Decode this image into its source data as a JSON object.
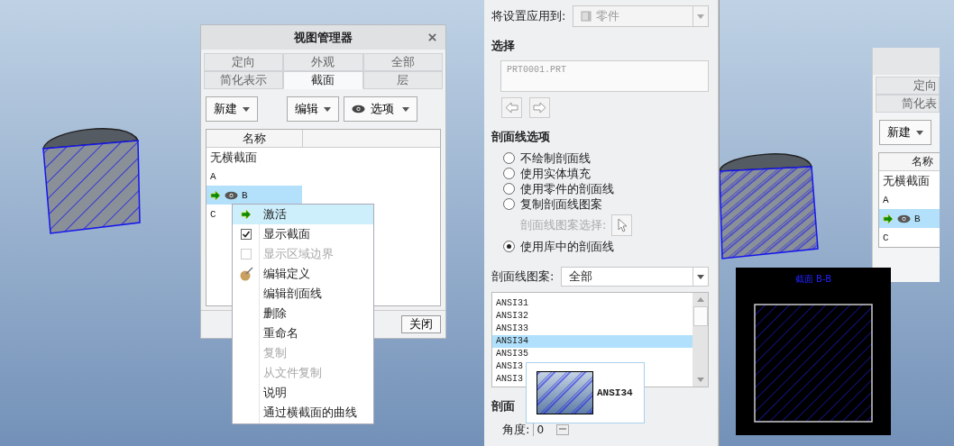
{
  "left_view": {
    "view_manager": {
      "title": "视图管理器",
      "tab_rows": [
        {
          "tabs": [
            {
              "label": "定向",
              "selected": false
            },
            {
              "label": "外观",
              "selected": false
            },
            {
              "label": "全部",
              "selected": false
            }
          ]
        },
        {
          "tabs": [
            {
              "label": "简化表示",
              "selected": false
            },
            {
              "label": "截面",
              "selected": true
            },
            {
              "label": "层",
              "selected": false
            }
          ]
        }
      ],
      "toolbar": [
        {
          "label": "新建",
          "kind": "plain"
        },
        {
          "label": "编辑",
          "kind": "plain"
        },
        {
          "label": "选项",
          "kind": "eye"
        }
      ],
      "column": "名称",
      "rows": [
        {
          "label": "无横截面",
          "selected": false,
          "active": false,
          "shown": false
        },
        {
          "label": "A",
          "selected": false,
          "active": false,
          "shown": false
        },
        {
          "label": "B",
          "selected": true,
          "active": true,
          "shown": true
        },
        {
          "label": "C",
          "selected": false,
          "active": false,
          "shown": false
        }
      ],
      "close_button": "关闭"
    },
    "context_menu": [
      {
        "label": "激活",
        "kind": "arrow",
        "selected": true,
        "disabled": false
      },
      {
        "label": "显示截面",
        "kind": "checkbox",
        "checked": true,
        "selected": false,
        "disabled": false
      },
      {
        "label": "显示区域边界",
        "kind": "checkbox",
        "checked": false,
        "selected": false,
        "disabled": true
      },
      {
        "label": "编辑定义",
        "kind": "brush",
        "selected": false,
        "disabled": false
      },
      {
        "label": "编辑剖面线",
        "kind": "plain",
        "selected": false,
        "disabled": false
      },
      {
        "label": "删除",
        "kind": "plain",
        "selected": false,
        "disabled": false
      },
      {
        "label": "重命名",
        "kind": "plain",
        "selected": false,
        "disabled": false
      },
      {
        "label": "复制",
        "kind": "plain",
        "selected": false,
        "disabled": true
      },
      {
        "label": "从文件复制",
        "kind": "plain",
        "selected": false,
        "disabled": true
      },
      {
        "label": "说明",
        "kind": "plain",
        "selected": false,
        "disabled": false
      },
      {
        "label": "通过横截面的曲线",
        "kind": "plain",
        "selected": false,
        "disabled": false
      }
    ]
  },
  "settings_panel": {
    "apply_to": {
      "label": "将设置应用到:",
      "value": "零件"
    },
    "selection": {
      "heading": "选择",
      "value": "PRT0001.PRT"
    },
    "hatch_options": {
      "heading": "剖面线选项",
      "options": [
        {
          "kind": "radio",
          "label": "不绘制剖面线",
          "selected": false
        },
        {
          "kind": "radio",
          "label": "使用实体填充",
          "selected": false
        },
        {
          "kind": "radio",
          "label": "使用零件的剖面线",
          "selected": false
        },
        {
          "kind": "radio",
          "label": "复制剖面线图案",
          "selected": false
        },
        {
          "kind": "picker",
          "label": "剖面线图案选择:",
          "disabled": true
        },
        {
          "kind": "radio",
          "label": "使用库中的剖面线",
          "selected": true
        }
      ]
    },
    "pattern": {
      "label": "剖面线图案:",
      "value": "全部"
    },
    "patterns": [
      {
        "label": "ANSI31",
        "selected": false
      },
      {
        "label": "ANSI32",
        "selected": false
      },
      {
        "label": "ANSI33",
        "selected": false
      },
      {
        "label": "ANSI34",
        "selected": true
      },
      {
        "label": "ANSI35",
        "selected": false
      },
      {
        "label": "ANSI3",
        "selected": false
      },
      {
        "label": "ANSI3",
        "selected": false
      }
    ],
    "tooltip": {
      "label": "ANSI34"
    },
    "section_heading": "剖面",
    "angle": {
      "label": "角度:",
      "value": "0"
    }
  },
  "right_view": {
    "view_manager": {
      "tabs": [
        {
          "label": "定向",
          "selected": false
        },
        {
          "label": "简化表",
          "selected": false
        }
      ],
      "toolbar": [
        {
          "label": "新建",
          "kind": "plain"
        }
      ],
      "column": "名称",
      "rows": [
        {
          "label": "无横截面",
          "selected": false,
          "active": false,
          "shown": false
        },
        {
          "label": "A",
          "selected": false,
          "active": false,
          "shown": false
        },
        {
          "label": "B",
          "selected": true,
          "active": true,
          "shown": true
        },
        {
          "label": "C",
          "selected": false,
          "active": false,
          "shown": false
        }
      ]
    },
    "drawing_window": {
      "title": "截面 B-B"
    }
  }
}
